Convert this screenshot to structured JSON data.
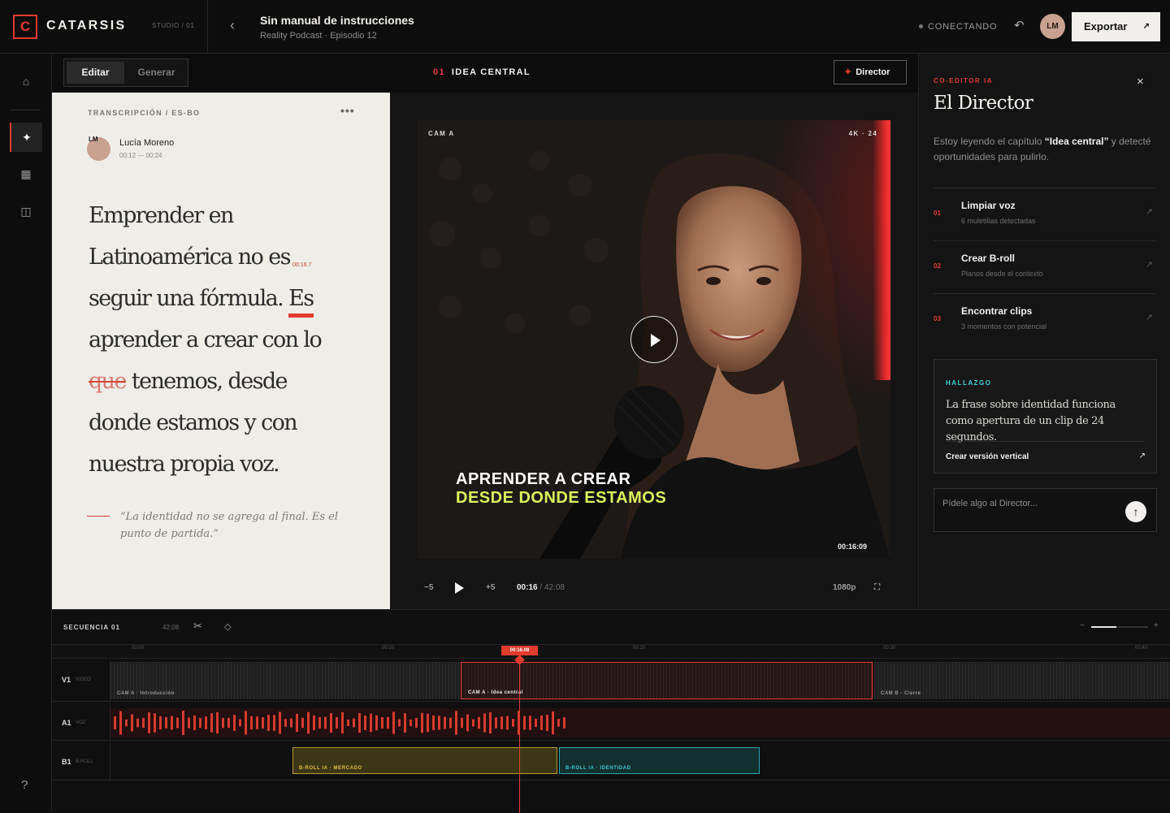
{
  "topbar": {
    "logo_letter": "C",
    "brand": "CATARSIS",
    "studio": "STUDIO / 01",
    "back_icon": "chevron-left-icon",
    "title": "Sin manual de instrucciones",
    "subtitle": "Reality Podcast · Episodio 12",
    "status": "CONECTANDO",
    "undo_icon": "undo-icon",
    "avatar_initials": "LM",
    "export_label": "Exportar",
    "export_arrow": "↗"
  },
  "rail": {
    "items": [
      {
        "name": "home-icon",
        "glyph": "⌂"
      },
      {
        "name": "sparkle-icon",
        "glyph": "✦"
      },
      {
        "name": "grid-icon",
        "glyph": "▦"
      },
      {
        "name": "columns-icon",
        "glyph": "◫"
      }
    ],
    "help_glyph": "?"
  },
  "editor": {
    "tabs": [
      "Editar",
      "Generar"
    ],
    "section_number": "01",
    "section_title": "IDEA CENTRAL",
    "director_button": "Director",
    "director_button_icon": "✦"
  },
  "transcript": {
    "label": "TRANSCRIPCIÓN / ES-BO",
    "more": "•••",
    "speaker_initials": "LM",
    "speaker": "Lucía Moreno",
    "time_range": "00:12 — 00:24",
    "text_before": "Emprender en Latinoamérica no es seguir una fórmula. ",
    "highlight": "Es",
    "text_middle": " aprender a crear con lo ",
    "struck": "que",
    "text_after": " tenemos, desde donde estamos y con nuestra propia voz.",
    "timestamp_marker": "00:16.7",
    "quote": "“La identidad no se agrega al final. Es el punto de partida.”"
  },
  "player": {
    "camera": "CAM A",
    "resolution": "4K · 24",
    "caption_line1": "APRENDER A CREAR",
    "caption_line2": "DESDE DONDE ESTAMOS",
    "timecode": "00:16:09",
    "rewind": "−5",
    "forward": "+5",
    "current": "00:16",
    "total": "/ 42:08",
    "quality": "1080p",
    "fullscreen": "⛶"
  },
  "director": {
    "kicker": "CO-EDITOR IA",
    "close": "×",
    "title": "El Director",
    "intro_before": "Estoy leyendo el capítulo ",
    "intro_bold": "“Idea central”",
    "intro_after": " y detecté oportunidades para pulirlo.",
    "suggestions": [
      {
        "num": "01",
        "title": "Limpiar voz",
        "sub": "6 muletillas detectadas"
      },
      {
        "num": "02",
        "title": "Crear B-roll",
        "sub": "Planos desde el contexto"
      },
      {
        "num": "03",
        "title": "Encontrar clips",
        "sub": "3 momentos con potencial"
      }
    ],
    "finding_kicker": "HALLAZGO",
    "finding_text": "La frase sobre identidad funciona como apertura de un clip de 24 segundos.",
    "finding_cta": "Crear versión vertical",
    "ask_placeholder": "Pídele algo al Director...",
    "send_icon": "↑"
  },
  "timeline": {
    "name": "SECUENCIA 01",
    "duration": "42:08",
    "ruler": [
      "00:00",
      "00:10",
      "00:20",
      "00:30",
      "00:40"
    ],
    "playhead": "00:16.09",
    "tracks": [
      {
        "id": "V1",
        "type": "VIDEO"
      },
      {
        "id": "A1",
        "type": "VOZ"
      },
      {
        "id": "B1",
        "type": "B-ROLL"
      }
    ],
    "video_clips": [
      "CAM A · Introducción",
      "CAM A · Idea central",
      "CAM B · Cierre"
    ],
    "broll_clips": [
      "B-ROLL IA · MERCADO",
      "B-ROLL IA · IDENTIDAD"
    ]
  },
  "colors": {
    "accent": "#e23b2e",
    "caption_accent": "#d9f45c",
    "finding": "#3fd4d8",
    "broll_yellow": "#e2c13c",
    "broll_teal": "#3fc8d6"
  }
}
